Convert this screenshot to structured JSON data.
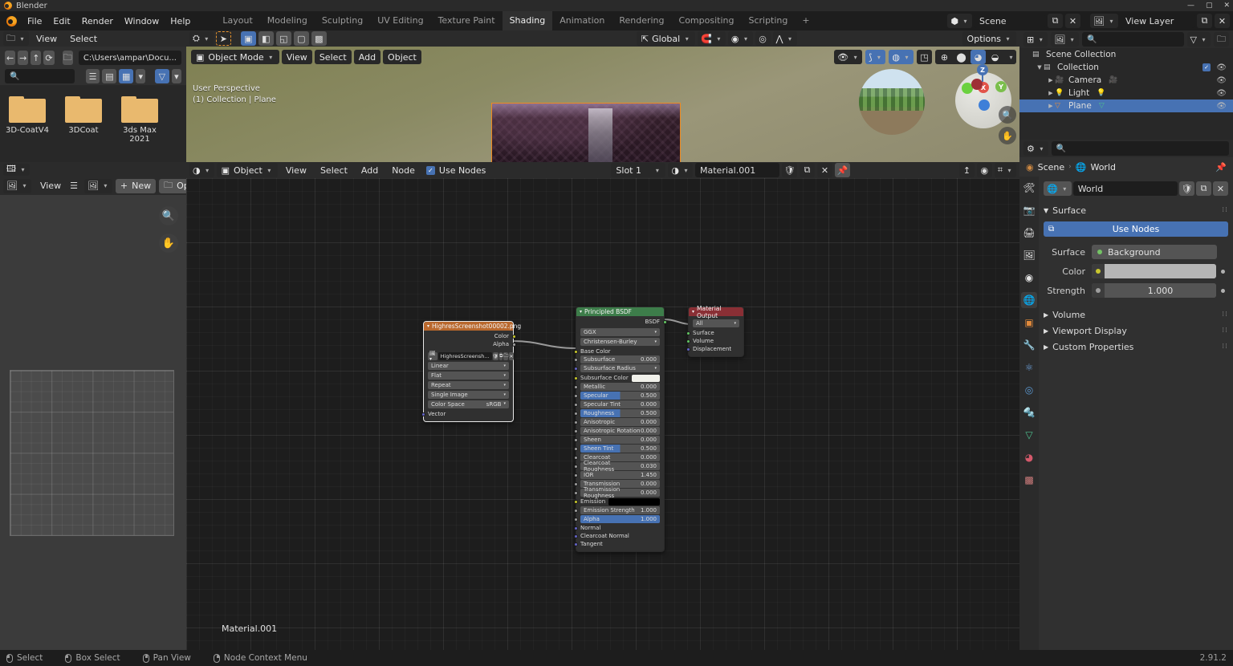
{
  "app": {
    "title": "Blender",
    "version": "2.91.2"
  },
  "topbar": {
    "menus": [
      "File",
      "Edit",
      "Render",
      "Window",
      "Help"
    ],
    "workspaces": [
      {
        "label": "Layout",
        "active": false
      },
      {
        "label": "Modeling",
        "active": false
      },
      {
        "label": "Sculpting",
        "active": false
      },
      {
        "label": "UV Editing",
        "active": false
      },
      {
        "label": "Texture Paint",
        "active": false
      },
      {
        "label": "Shading",
        "active": true
      },
      {
        "label": "Animation",
        "active": false
      },
      {
        "label": "Rendering",
        "active": false
      },
      {
        "label": "Compositing",
        "active": false
      },
      {
        "label": "Scripting",
        "active": false
      }
    ],
    "add_workspace": "+",
    "scene_name": "Scene",
    "view_layer_name": "View Layer"
  },
  "file_browser": {
    "menus": [
      "View",
      "Select"
    ],
    "path": "C:\\Users\\ampar\\Docu...",
    "search_placeholder": "",
    "items": [
      {
        "name": "3D-CoatV4"
      },
      {
        "name": "3DCoat"
      },
      {
        "name": "3ds Max 2021"
      }
    ]
  },
  "image_editor": {
    "view_menu": "View",
    "new_button": "New",
    "open_button": "Open"
  },
  "viewport": {
    "mode": "Object Mode",
    "menus": [
      "View",
      "Select",
      "Add",
      "Object"
    ],
    "orientation": "Global",
    "options_label": "Options",
    "overlay_text_line1": "User Perspective",
    "overlay_text_line2": "(1) Collection | Plane",
    "gizmo_axes": [
      "Z",
      "X",
      "Y"
    ]
  },
  "shader_editor": {
    "type": "Object",
    "menus": [
      "View",
      "Select",
      "Add",
      "Node"
    ],
    "use_nodes_label": "Use Nodes",
    "use_nodes_checked": true,
    "slot": "Slot 1",
    "material_name": "Material.001",
    "canvas_label": "Material.001"
  },
  "nodes": {
    "image_texture": {
      "title": "HighresScreenshot00002.png",
      "header_color": "#b9682d",
      "outputs": [
        "Color",
        "Alpha"
      ],
      "filename": "HighresScreensh...",
      "interpolation": "Linear",
      "projection": "Flat",
      "extension": "Repeat",
      "source": "Single Image",
      "colorspace_label": "Color Space",
      "colorspace_value": "sRGB",
      "input_vector": "Vector"
    },
    "principled_bsdf": {
      "title": "Principled BSDF",
      "header_color": "#3d7d4a",
      "output": "BSDF",
      "distribution": "GGX",
      "subsurface_method": "Christensen-Burley",
      "inputs": [
        {
          "name": "Base Color",
          "type": "socket",
          "socket": "yellow"
        },
        {
          "name": "Subsurface",
          "type": "value",
          "value": "0.000",
          "pct": 0,
          "socket": "gray"
        },
        {
          "name": "Subsurface Radius",
          "type": "dropdown",
          "socket": "purple"
        },
        {
          "name": "Subsurface Color",
          "type": "color",
          "color": "#f0f0ea",
          "socket": "yellow"
        },
        {
          "name": "Metallic",
          "type": "value",
          "value": "0.000",
          "pct": 0,
          "socket": "gray"
        },
        {
          "name": "Specular",
          "type": "value",
          "value": "0.500",
          "pct": 50,
          "socket": "gray"
        },
        {
          "name": "Specular Tint",
          "type": "value",
          "value": "0.000",
          "pct": 0,
          "socket": "gray"
        },
        {
          "name": "Roughness",
          "type": "value",
          "value": "0.500",
          "pct": 50,
          "socket": "gray"
        },
        {
          "name": "Anisotropic",
          "type": "value",
          "value": "0.000",
          "pct": 0,
          "socket": "gray"
        },
        {
          "name": "Anisotropic Rotation",
          "type": "value",
          "value": "0.000",
          "pct": 0,
          "socket": "gray"
        },
        {
          "name": "Sheen",
          "type": "value",
          "value": "0.000",
          "pct": 0,
          "socket": "gray"
        },
        {
          "name": "Sheen Tint",
          "type": "value",
          "value": "0.500",
          "pct": 50,
          "socket": "gray"
        },
        {
          "name": "Clearcoat",
          "type": "value",
          "value": "0.000",
          "pct": 0,
          "socket": "gray"
        },
        {
          "name": "Clearcoat Roughness",
          "type": "value",
          "value": "0.030",
          "pct": 3,
          "socket": "gray"
        },
        {
          "name": "IOR",
          "type": "value",
          "value": "1.450",
          "pct": 0,
          "socket": "gray"
        },
        {
          "name": "Transmission",
          "type": "value",
          "value": "0.000",
          "pct": 0,
          "socket": "gray"
        },
        {
          "name": "Transmission Roughness",
          "type": "value",
          "value": "0.000",
          "pct": 0,
          "socket": "gray"
        },
        {
          "name": "Emission",
          "type": "color",
          "color": "#000000",
          "socket": "yellow"
        },
        {
          "name": "Emission Strength",
          "type": "value",
          "value": "1.000",
          "pct": 0,
          "socket": "gray"
        },
        {
          "name": "Alpha",
          "type": "value",
          "value": "1.000",
          "pct": 100,
          "socket": "gray"
        },
        {
          "name": "Normal",
          "type": "socket",
          "socket": "purple"
        },
        {
          "name": "Clearcoat Normal",
          "type": "socket",
          "socket": "purple"
        },
        {
          "name": "Tangent",
          "type": "socket",
          "socket": "purple"
        }
      ]
    },
    "material_output": {
      "title": "Material Output",
      "header_color": "#8a2f35",
      "target": "All",
      "inputs": [
        "Surface",
        "Volume",
        "Displacement"
      ]
    }
  },
  "outliner": {
    "search_placeholder": "",
    "rows": [
      {
        "label": "Scene Collection",
        "indent": 0,
        "icon": "collection-icon",
        "has_tri": false,
        "selected": false,
        "eye": false,
        "check": false
      },
      {
        "label": "Collection",
        "indent": 1,
        "icon": "collection-icon",
        "has_tri": true,
        "selected": false,
        "eye": true,
        "check": true
      },
      {
        "label": "Camera",
        "indent": 2,
        "icon": "camera-icon",
        "has_tri": true,
        "selected": false,
        "eye": true,
        "check": false
      },
      {
        "label": "Light",
        "indent": 2,
        "icon": "light-icon",
        "has_tri": true,
        "selected": false,
        "eye": true,
        "check": false
      },
      {
        "label": "Plane",
        "indent": 2,
        "icon": "mesh-icon",
        "has_tri": true,
        "selected": true,
        "eye": true,
        "check": false
      }
    ]
  },
  "properties": {
    "breadcrumb": [
      "Scene",
      "World"
    ],
    "datablock_name": "World",
    "search_placeholder": "",
    "surface_section": "Surface",
    "use_nodes_button": "Use Nodes",
    "rows": [
      {
        "label": "Surface",
        "value": "Background",
        "kind": "enum"
      },
      {
        "label": "Color",
        "value": "",
        "kind": "color"
      },
      {
        "label": "Strength",
        "value": "1.000",
        "kind": "number"
      }
    ],
    "sections": [
      "Volume",
      "Viewport Display",
      "Custom Properties"
    ]
  },
  "status_bar": {
    "items": [
      {
        "icon": "mouse-left-icon",
        "label": "Select"
      },
      {
        "icon": "mouse-left-drag-icon",
        "label": "Box Select"
      },
      {
        "icon": "mouse-middle-icon",
        "label": "Pan View"
      },
      {
        "icon": "mouse-right-icon",
        "label": "Node Context Menu"
      }
    ]
  },
  "colors": {
    "accent": "#4772b3",
    "orange": "#ef8a20",
    "panel": "#303030",
    "dark": "#1d1d1d"
  }
}
